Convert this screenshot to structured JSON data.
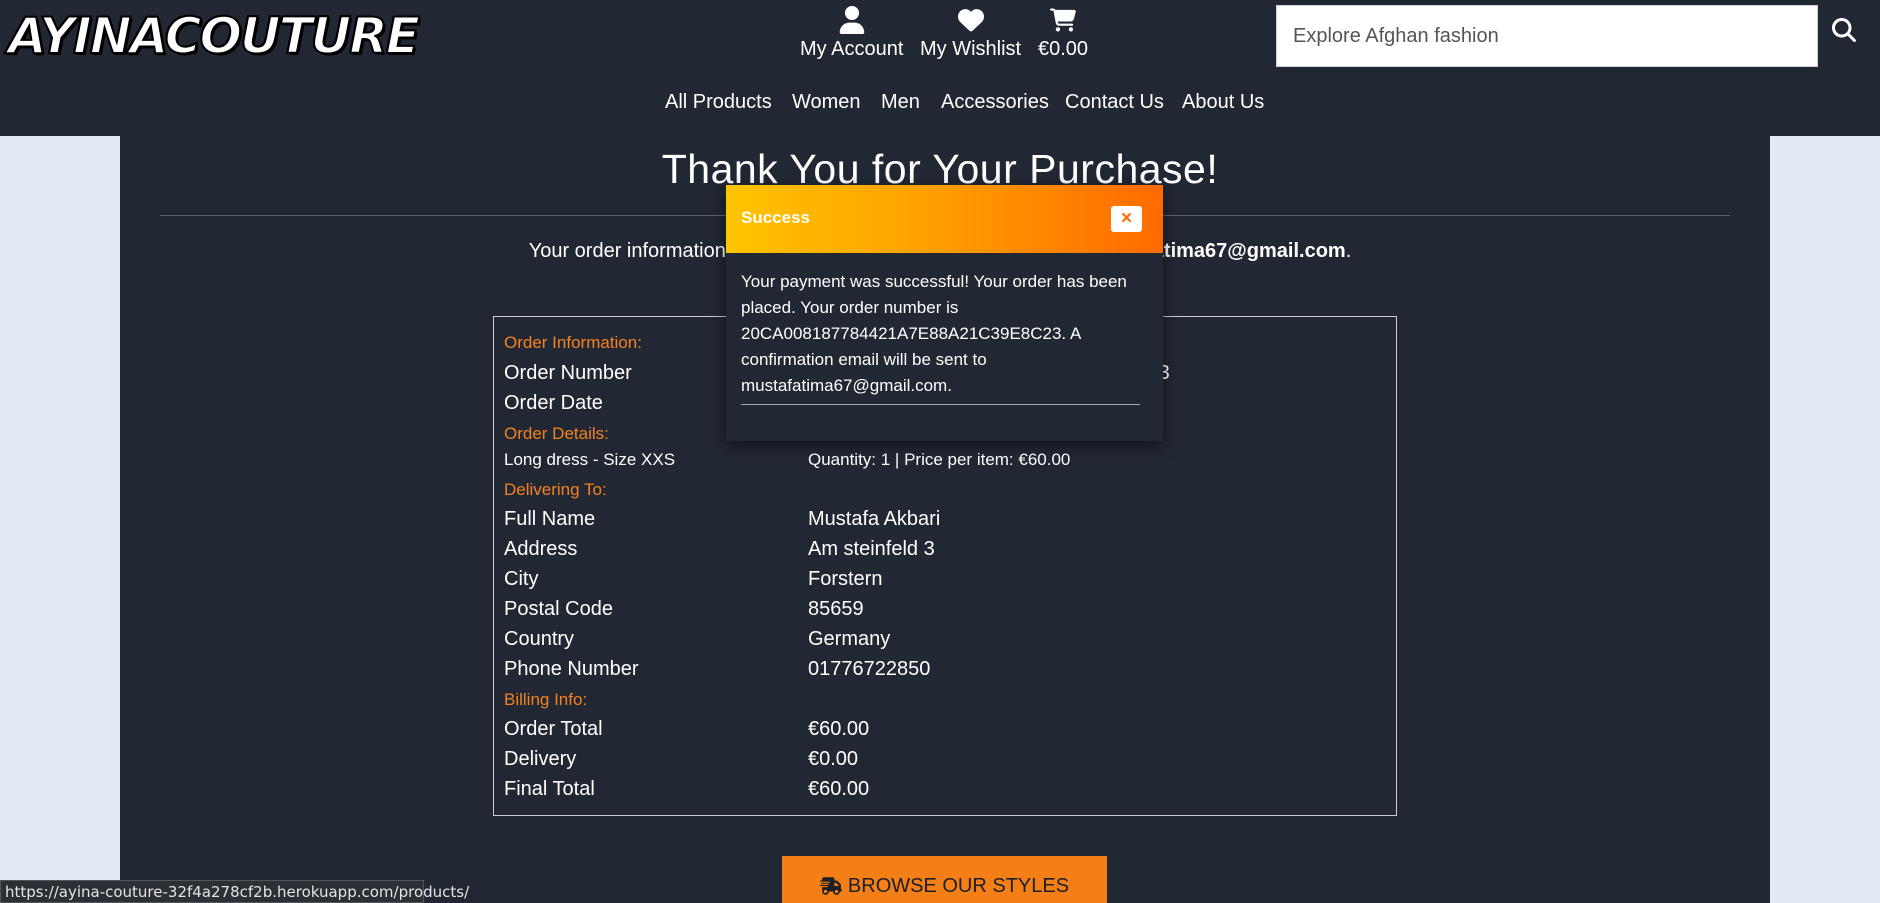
{
  "brand": {
    "logo_text": "AYINACOUTURE"
  },
  "header": {
    "account_label": "My Account",
    "wishlist_label": "My Wishlist",
    "cart_total": "€0.00",
    "search": {
      "placeholder": "Explore Afghan fashion"
    },
    "nav": [
      "All Products",
      "Women",
      "Men",
      "Accessories",
      "Contact Us",
      "About Us"
    ]
  },
  "page": {
    "title": "Thank You for Your Purchase!",
    "order_info_prefix": "Your order information",
    "order_info_email": "afatima67@gmail.com",
    "order_info_suffix": "."
  },
  "order": {
    "section_info": "Order Information:",
    "order_number_label": "Order Number",
    "order_number_value_tail": "C23",
    "order_date_label": "Order Date",
    "section_details": "Order Details:",
    "item_name": "Long dress - Size XXS",
    "item_detail": "Quantity: 1 | Price per item: €60.00",
    "section_delivery": "Delivering To:",
    "full_name_label": "Full Name",
    "full_name": "Mustafa Akbari",
    "address_label": "Address",
    "address": "Am steinfeld 3",
    "city_label": "City",
    "city": "Forstern",
    "postal_label": "Postal Code",
    "postal": "85659",
    "country_label": "Country",
    "country": "Germany",
    "phone_label": "Phone Number",
    "phone": "01776722850",
    "section_billing": "Billing Info:",
    "order_total_label": "Order Total",
    "order_total": "€60.00",
    "delivery_label": "Delivery",
    "delivery": "€0.00",
    "final_total_label": "Final Total",
    "final_total": "€60.00"
  },
  "browse_button_label": "BROWSE OUR STYLES",
  "toast": {
    "title": "Success",
    "close_label": "×",
    "message": "Your payment was successful! Your order has been placed. Your order number is 20CA008187784421A7E88A21C39E8C23. A confirmation email will be sent to mustafatima67@gmail.com."
  },
  "status_url": "https://ayina-couture-32f4a278cf2b.herokuapp.com/products/",
  "colors": {
    "header_bg": "#212733",
    "accent": "#f47f17",
    "page_bg": "#e4eaf4"
  }
}
